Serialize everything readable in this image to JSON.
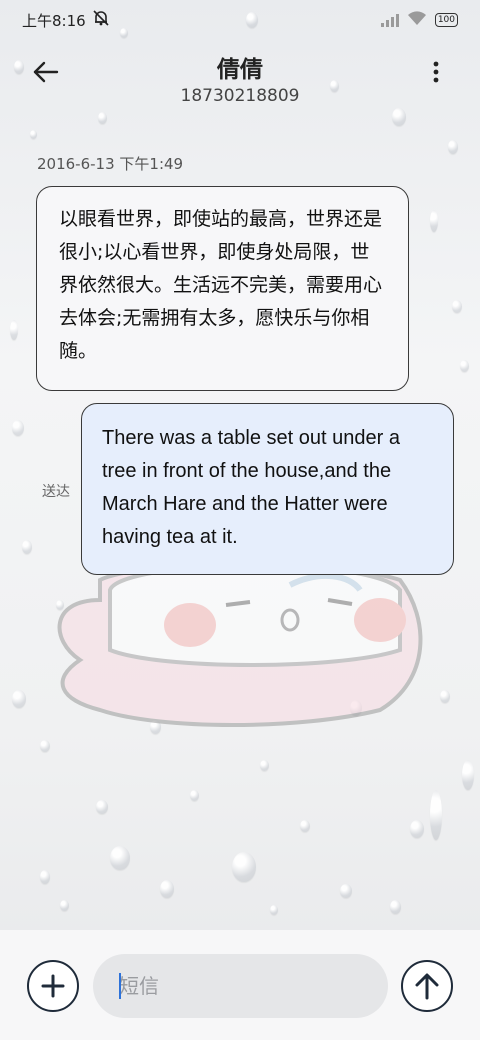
{
  "status_bar": {
    "time": "上午8:16",
    "mute_icon": "bell-off-icon",
    "battery": "100"
  },
  "header": {
    "name": "倩倩",
    "number": "18730218809",
    "back_icon": "arrow-left-icon",
    "menu_icon": "more-vertical-icon"
  },
  "messages": {
    "timestamp": "2016-6-13 下午1:49",
    "incoming_text": "以眼看世界，即使站的最高，世界还是很小;以心看世界，即使身处局限，世界依然很大。生活远不完美，需要用心去体会;无需拥有太多，愿快乐与你相随。",
    "outgoing_text": "There was a table set out under a tree in front of the house,and the March Hare and the Hatter were having tea at it.",
    "sent_status": "送达"
  },
  "composer": {
    "placeholder": "短信",
    "add_icon": "plus-icon",
    "send_icon": "arrow-up-icon"
  }
}
